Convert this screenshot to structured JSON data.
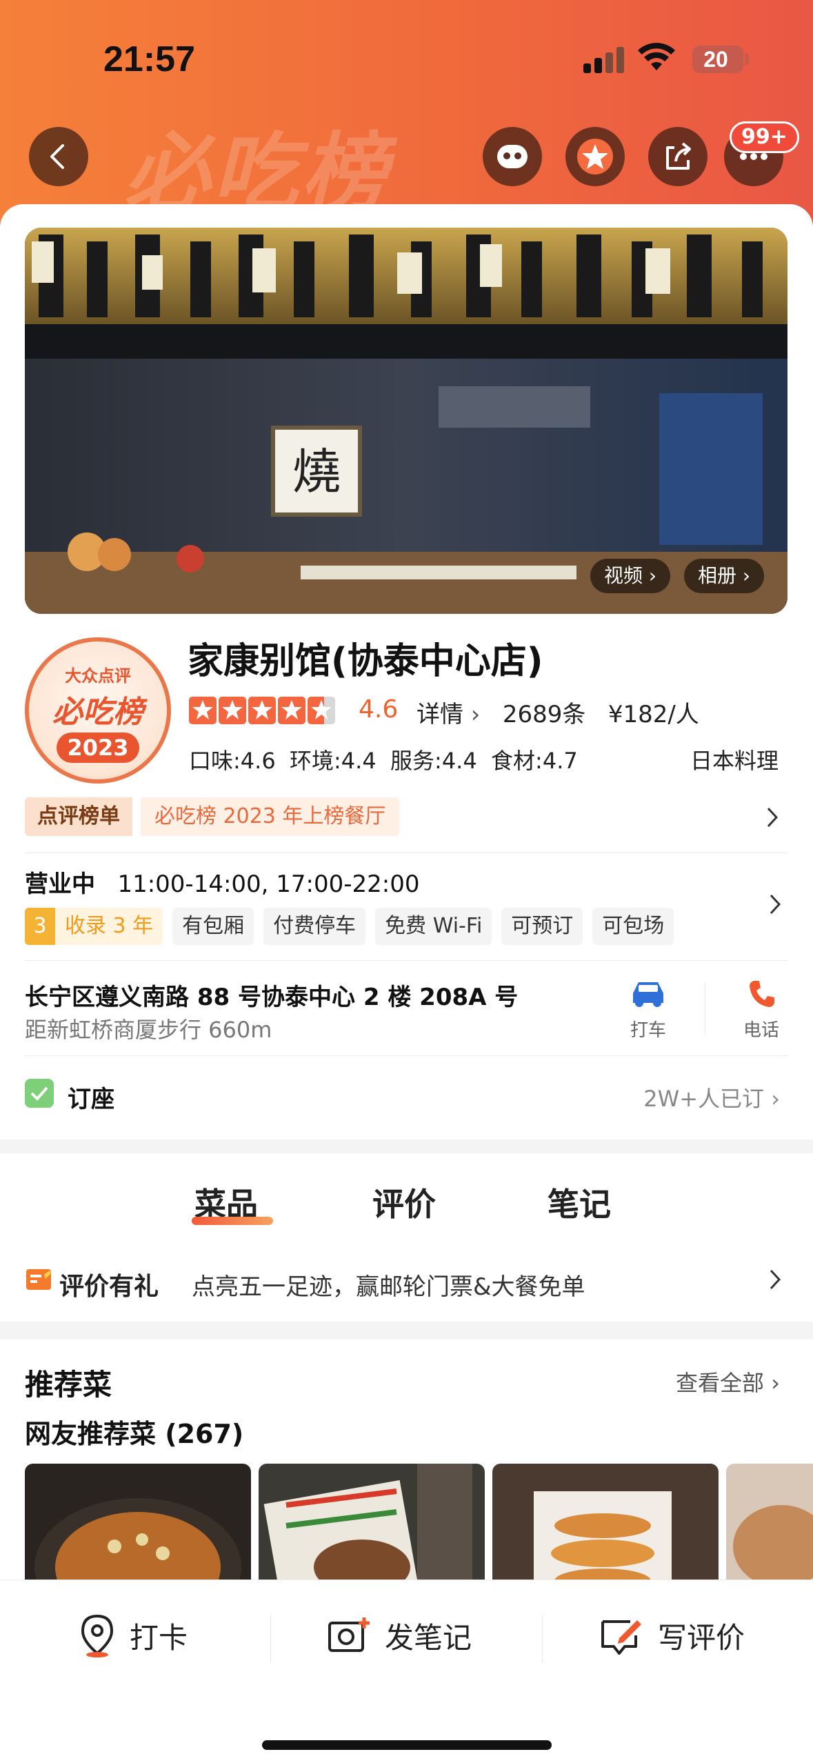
{
  "status_bar": {
    "time": "21:57",
    "battery": "20"
  },
  "header": {
    "watermark": "必吃榜",
    "message_badge": "99+",
    "colors": {
      "gradient_start": "#f5803a",
      "gradient_end": "#e95745"
    }
  },
  "hero": {
    "video_label": "视频",
    "album_label": "相册"
  },
  "logo": {
    "brand": "大众点评",
    "title": "必吃榜",
    "year": "2023"
  },
  "shop": {
    "name": "家康别馆(协泰中心店)",
    "rating": "4.6",
    "details_label": "详情",
    "review_count": "2689条",
    "price": "¥182/人",
    "sub_scores": "口味:4.6  环境:4.4  服务:4.4  食材:4.7",
    "cuisine": "日本料理"
  },
  "ranking": {
    "tag": "点评榜单",
    "text": "必吃榜 2023 年上榜餐厅"
  },
  "hours": {
    "status": "营业中",
    "times": "11:00-14:00, 17:00-22:00"
  },
  "tags": {
    "collect_num": "3",
    "collect_text": "收录 3 年",
    "items": [
      "有包厢",
      "付费停车",
      "免费 Wi-Fi",
      "可预订",
      "可包场"
    ]
  },
  "address": {
    "line": "长宁区遵义南路 88 号协泰中心 2 楼 208A 号",
    "distance": "距新虹桥商厦步行 660m",
    "taxi_label": "打车",
    "phone_label": "电话"
  },
  "booking": {
    "label": "订座",
    "count": "2W+人已订"
  },
  "tabs": [
    "菜品",
    "评价",
    "笔记"
  ],
  "promo": {
    "title": "评价有礼",
    "text": "点亮五一足迹，赢邮轮门票&大餐免单"
  },
  "recommend": {
    "title": "推荐菜",
    "view_all": "查看全部",
    "subtitle": "网友推荐菜 (267)"
  },
  "bottom_bar": {
    "checkin": "打卡",
    "post_note": "发笔记",
    "write_review": "写评价"
  }
}
